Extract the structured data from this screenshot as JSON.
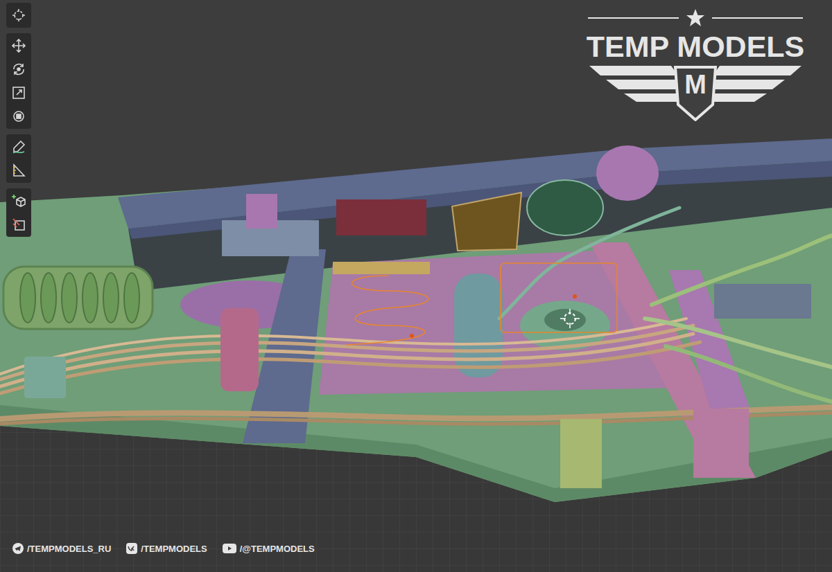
{
  "toolbar": {
    "groups": [
      {
        "tools": [
          {
            "kind": "cursor",
            "selected": false
          }
        ]
      },
      {
        "tools": [
          {
            "kind": "move",
            "selected": false
          },
          {
            "kind": "rotate",
            "selected": false
          },
          {
            "kind": "scale",
            "selected": false
          },
          {
            "kind": "transform",
            "selected": false
          }
        ]
      },
      {
        "tools": [
          {
            "kind": "annotate",
            "selected": false
          },
          {
            "kind": "measure",
            "selected": false
          }
        ]
      },
      {
        "tools": [
          {
            "kind": "add",
            "selected": false
          },
          {
            "kind": "cut",
            "selected": false
          }
        ]
      }
    ]
  },
  "logo": {
    "title": "TEMP MODELS",
    "monogram": "M"
  },
  "viewport": {
    "selected": true
  },
  "socials": [
    {
      "kind": "telegram",
      "label": "/TEMPMODELS_RU"
    },
    {
      "kind": "vk",
      "label": "/TEMPMODELS"
    },
    {
      "kind": "youtube",
      "label": "/@TEMPMODELS"
    }
  ]
}
